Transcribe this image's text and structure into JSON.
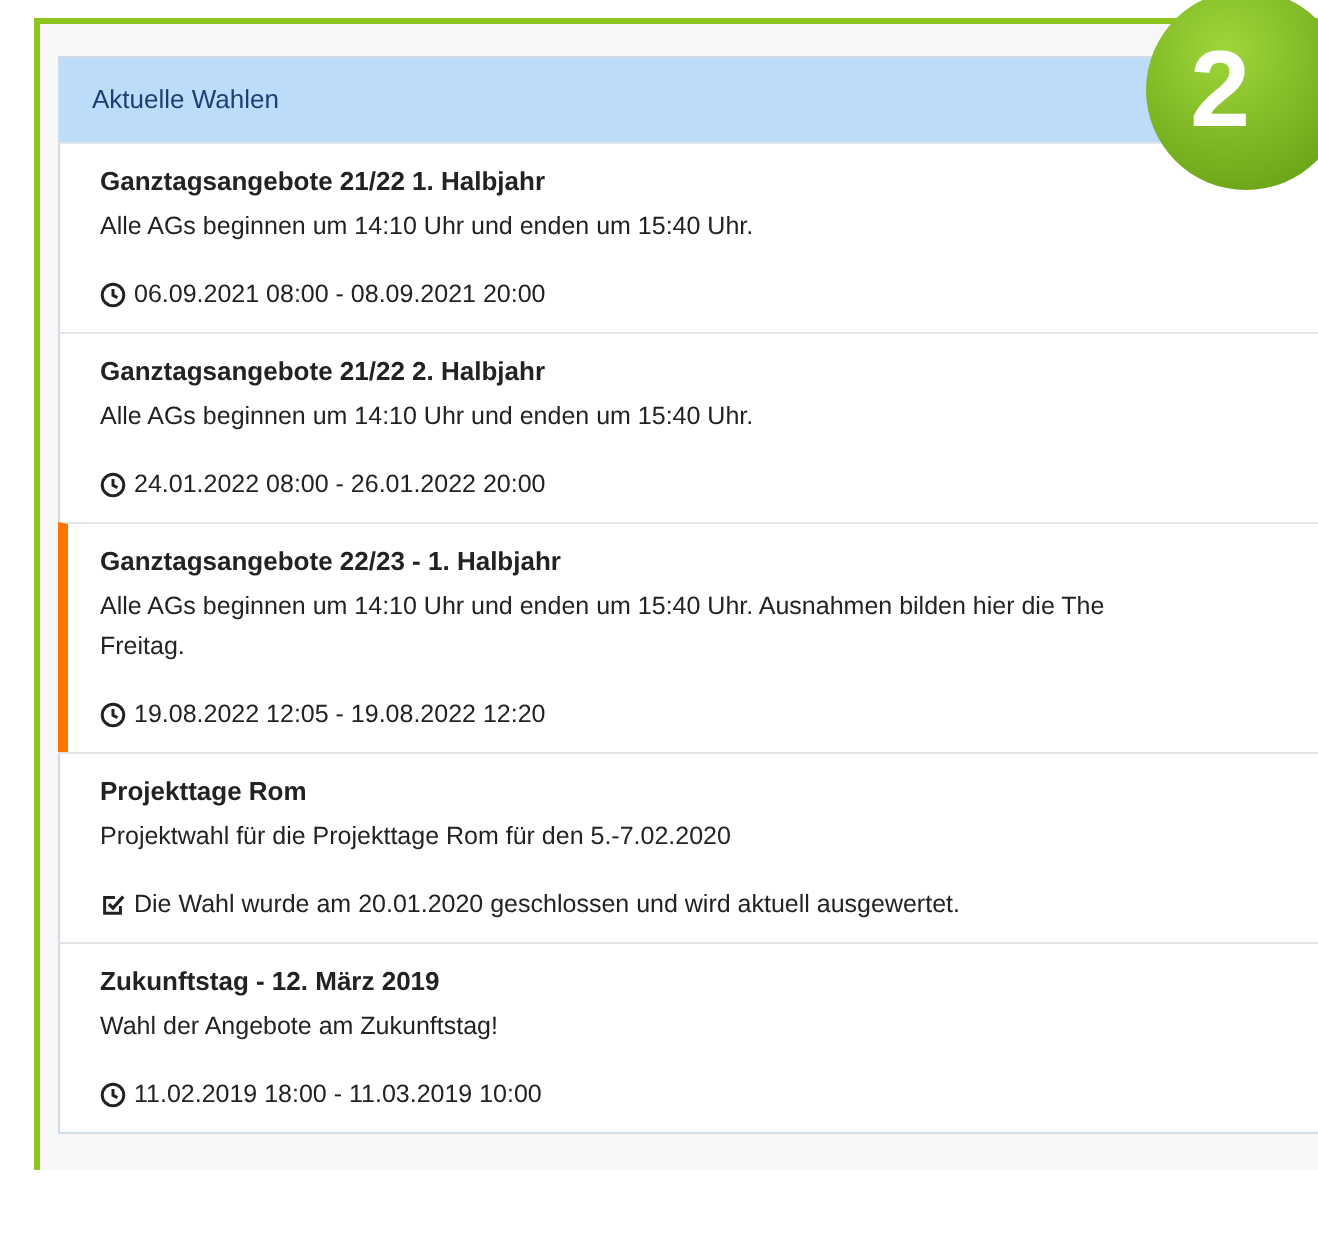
{
  "badge": {
    "label": "2"
  },
  "panel": {
    "title": "Aktuelle Wahlen"
  },
  "elections": [
    {
      "title": "Ganztagsangebote 21/22 1. Halbjahr",
      "description": [
        "Alle AGs beginnen um 14:10 Uhr und enden um 15:40 Uhr."
      ],
      "kind": "period",
      "footer": "06.09.2021 08:00 - 08.09.2021 20:00",
      "selected": false
    },
    {
      "title": "Ganztagsangebote 21/22 2. Halbjahr",
      "description": [
        "Alle AGs beginnen um 14:10 Uhr und enden um 15:40 Uhr."
      ],
      "kind": "period",
      "footer": "24.01.2022 08:00 - 26.01.2022 20:00",
      "selected": false
    },
    {
      "title": "Ganztagsangebote 22/23 - 1. Halbjahr",
      "description": [
        "Alle AGs beginnen um 14:10 Uhr und enden um 15:40 Uhr. Ausnahmen bilden hier die The",
        "Freitag."
      ],
      "kind": "period",
      "footer": "19.08.2022 12:05 - 19.08.2022 12:20",
      "selected": true
    },
    {
      "title": "Projekttage Rom",
      "description": [
        "Projektwahl für die Projekttage Rom für den 5.-7.02.2020"
      ],
      "kind": "closed",
      "footer": "Die Wahl wurde am 20.01.2020 geschlossen und wird aktuell ausgewertet.",
      "selected": false
    },
    {
      "title": "Zukunftstag - 12. März 2019",
      "description": [
        "Wahl der Angebote am Zukunftstag!"
      ],
      "kind": "period",
      "footer": "11.02.2019 18:00 - 11.03.2019 10:00",
      "selected": false
    }
  ]
}
